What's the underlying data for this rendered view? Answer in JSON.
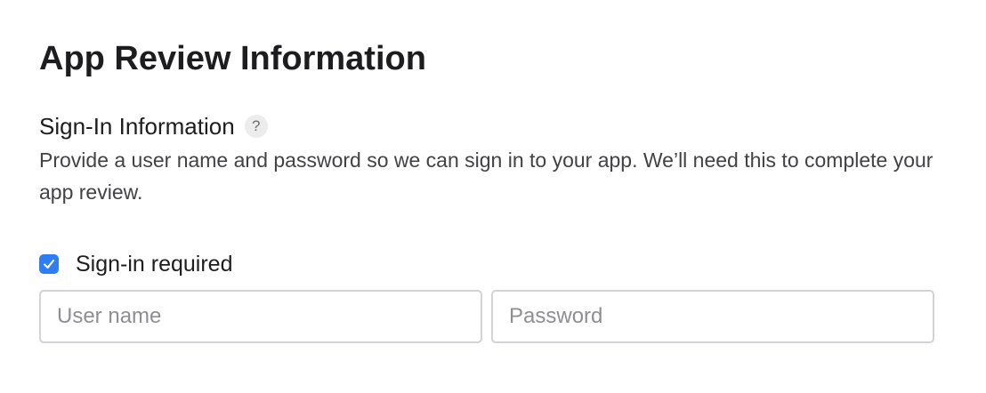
{
  "page": {
    "title": "App Review Information"
  },
  "sign_in_section": {
    "title": "Sign-In Information",
    "help_icon_symbol": "?",
    "help_icon": "question-mark-icon",
    "description": "Provide a user name and password so we can sign in to your app. We’ll need this to complete your app review.",
    "checkbox": {
      "label": "Sign-in required",
      "checked": true,
      "color": "#2f7df6",
      "icon": "checkmark-icon"
    },
    "username": {
      "value": "",
      "placeholder": "User name"
    },
    "password": {
      "value": "",
      "placeholder": "Password"
    }
  }
}
